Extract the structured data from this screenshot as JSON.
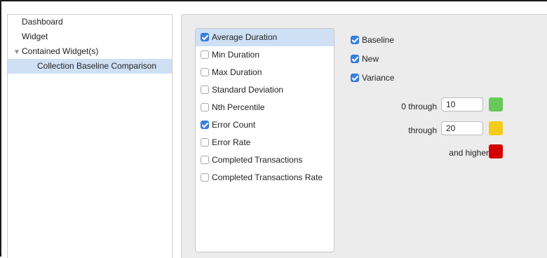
{
  "tree": {
    "items": [
      {
        "label": "Dashboard",
        "level": 0,
        "expander": false,
        "selected": false
      },
      {
        "label": "Widget",
        "level": 0,
        "expander": false,
        "selected": false
      },
      {
        "label": "Contained Widget(s)",
        "level": 0,
        "expander": true,
        "selected": false
      },
      {
        "label": "Collection Baseline Comparison",
        "level": 1,
        "expander": false,
        "selected": true
      }
    ]
  },
  "metrics": {
    "items": [
      {
        "label": "Average Duration",
        "checked": true,
        "selected": true
      },
      {
        "label": "Min Duration",
        "checked": false,
        "selected": false
      },
      {
        "label": "Max Duration",
        "checked": false,
        "selected": false
      },
      {
        "label": "Standard Deviation",
        "checked": false,
        "selected": false
      },
      {
        "label": "Nth Percentile",
        "checked": false,
        "selected": false
      },
      {
        "label": "Error Count",
        "checked": true,
        "selected": false
      },
      {
        "label": "Error Rate",
        "checked": false,
        "selected": false
      },
      {
        "label": "Completed Transactions",
        "checked": false,
        "selected": false
      },
      {
        "label": "Completed Transactions Rate",
        "checked": false,
        "selected": false
      }
    ]
  },
  "series": {
    "items": [
      {
        "label": "Baseline",
        "checked": true
      },
      {
        "label": "New",
        "checked": true
      },
      {
        "label": "Variance",
        "checked": true
      }
    ]
  },
  "thresholds": {
    "rows": [
      {
        "label": "0 through",
        "value": "10",
        "color": "#67c95a",
        "color_name": "green"
      },
      {
        "label": "through",
        "value": "20",
        "color": "#f5cc17",
        "color_name": "yellow"
      },
      {
        "label": "and higher",
        "value": null,
        "color": "#d40000",
        "color_name": "red"
      }
    ]
  }
}
